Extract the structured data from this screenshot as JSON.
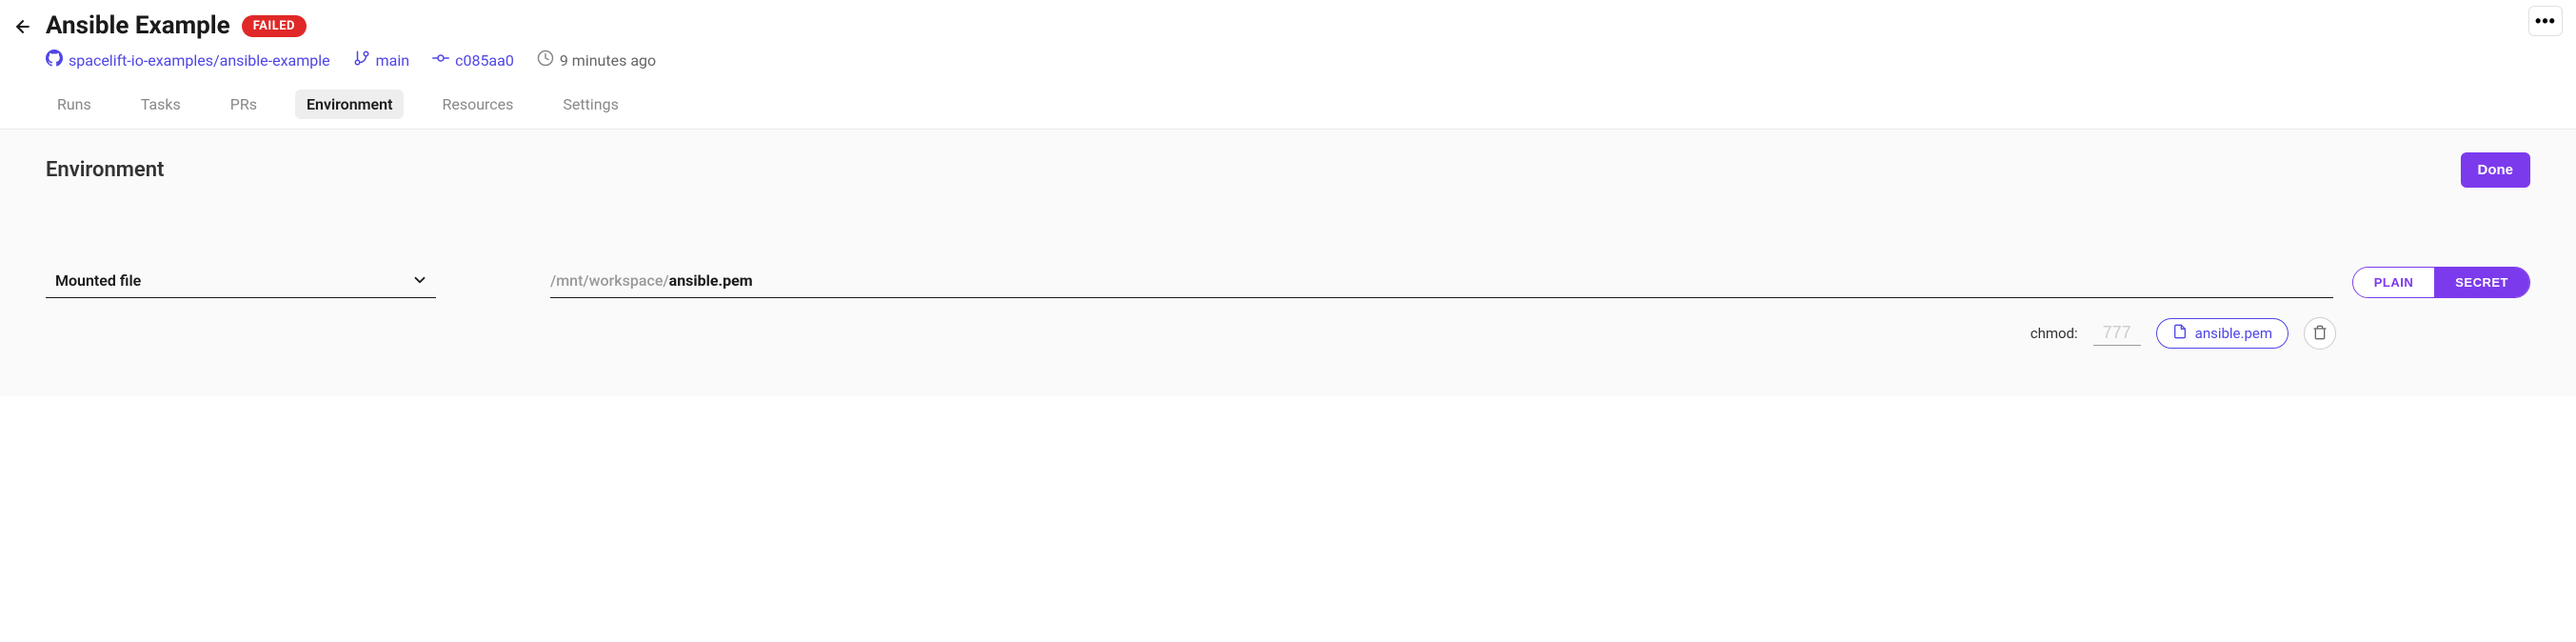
{
  "header": {
    "title": "Ansible Example",
    "status": "FAILED",
    "repo": "spacelift-io-examples/ansible-example",
    "branch": "main",
    "commit": "c085aa0",
    "timestamp": "9 minutes ago"
  },
  "tabs": [
    {
      "label": "Runs",
      "active": false
    },
    {
      "label": "Tasks",
      "active": false
    },
    {
      "label": "PRs",
      "active": false
    },
    {
      "label": "Environment",
      "active": true
    },
    {
      "label": "Resources",
      "active": false
    },
    {
      "label": "Settings",
      "active": false
    }
  ],
  "section": {
    "title": "Environment",
    "done_label": "Done"
  },
  "form": {
    "type_select": "Mounted file",
    "path_prefix": "/mnt/workspace/",
    "path_filename": "ansible.pem",
    "toggle": {
      "plain": "PLAIN",
      "secret": "SECRET",
      "active": "secret"
    },
    "chmod": {
      "label": "chmod:",
      "placeholder": "777",
      "value": ""
    },
    "file_chip": "ansible.pem"
  }
}
